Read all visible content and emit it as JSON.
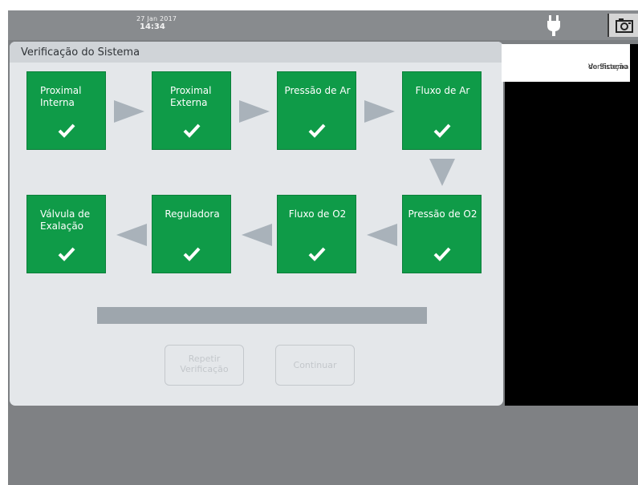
{
  "status_bar": {
    "date": "27 Jan 2017",
    "time": "14:34",
    "power_icon": "plug-icon",
    "screenshot_icon": "camera-icon"
  },
  "panel": {
    "title": "Verificação do Sistema"
  },
  "steps": [
    {
      "label": "Proximal Interna",
      "status": "check-icon"
    },
    {
      "label": "Proximal Externa",
      "status": "check-icon"
    },
    {
      "label": "Pressão de Ar",
      "status": "check-icon"
    },
    {
      "label": "Fluxo de Ar",
      "status": "check-icon"
    },
    {
      "label": "Pressão de O2",
      "status": "check-icon"
    },
    {
      "label": "Fluxo de O2",
      "status": "check-icon"
    },
    {
      "label": "Reguladora",
      "status": "check-icon"
    },
    {
      "label": "Válvula de Exalação",
      "status": "check-icon"
    }
  ],
  "buttons": {
    "repeat_line1": "Repetir",
    "repeat_line2": "Verificação",
    "continue": "Continuar"
  },
  "side_menu": {
    "line1": "Verificação",
    "line2": "do Sistema"
  },
  "colors": {
    "step_green": "#0f9b48",
    "arrow_gray": "#a9b2ba",
    "progress_gray": "#9ea6ad"
  }
}
